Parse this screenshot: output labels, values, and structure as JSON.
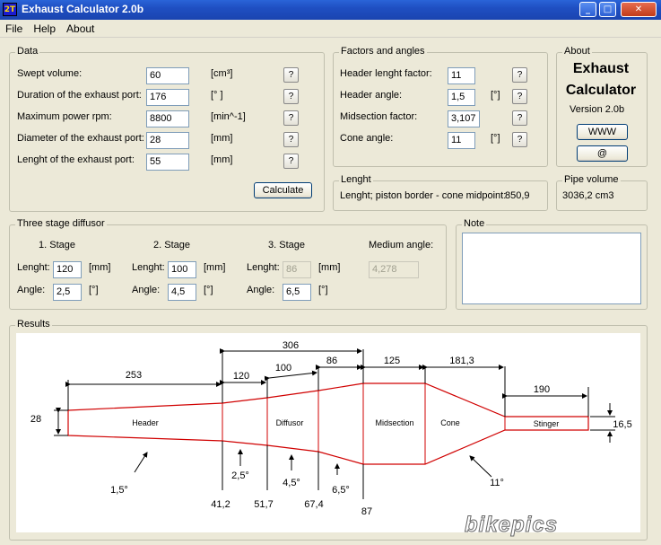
{
  "window": {
    "app_icon": "2T",
    "title": "Exhaust Calculator 2.0b",
    "min": "_",
    "max": "□",
    "close": "✕"
  },
  "menu": [
    "File",
    "Help",
    "About"
  ],
  "data_group": {
    "legend": "Data",
    "rows": [
      {
        "label": "Swept volume:",
        "value": "60",
        "unit": "[cm³]"
      },
      {
        "label": "Duration of the exhaust port:",
        "value": "176",
        "unit": "[° ]"
      },
      {
        "label": "Maximum power rpm:",
        "value": "8800",
        "unit": "[min^-1]"
      },
      {
        "label": "Diameter of the exhaust port:",
        "value": "28",
        "unit": "[mm]"
      },
      {
        "label": "Lenght of the exhaust port:",
        "value": "55",
        "unit": "[mm]"
      }
    ],
    "help": "?",
    "calculate": "Calculate"
  },
  "factors_group": {
    "legend": "Factors and angles",
    "rows": [
      {
        "label": "Header lenght factor:",
        "value": "11",
        "unit": ""
      },
      {
        "label": "Header angle:",
        "value": "1,5",
        "unit": "[°]"
      },
      {
        "label": "Midsection factor:",
        "value": "3,107",
        "unit": ""
      },
      {
        "label": "Cone angle:",
        "value": "11",
        "unit": "[°]"
      }
    ]
  },
  "about_group": {
    "legend": "About",
    "line1": "Exhaust",
    "line2": "Calculator",
    "version": "Version 2.0b",
    "www": "WWW",
    "mail": "@"
  },
  "lenght_group": {
    "legend": "Lenght",
    "text": "Lenght; piston border - cone midpoint:",
    "value": "850,9"
  },
  "pipe_group": {
    "legend": "Pipe volume",
    "value": "3036,2 cm3"
  },
  "diffusor_group": {
    "legend": "Three stage diffusor",
    "stages": [
      {
        "title": "1. Stage",
        "len_label": "Lenght:",
        "len": "120",
        "len_unit": "[mm]",
        "ang_label": "Angle:",
        "ang": "2,5",
        "ang_unit": "[°]"
      },
      {
        "title": "2. Stage",
        "len_label": "Lenght:",
        "len": "100",
        "len_unit": "[mm]",
        "ang_label": "Angle:",
        "ang": "4,5",
        "ang_unit": "[°]"
      },
      {
        "title": "3. Stage",
        "len_label": "Lenght:",
        "len": "86",
        "len_unit": "[mm]",
        "ang_label": "Angle:",
        "ang": "6,5",
        "ang_unit": "[°]"
      }
    ],
    "medium_label": "Medium angle:",
    "medium_value": "4,278"
  },
  "note_group": {
    "legend": "Note",
    "text": ""
  },
  "results_group": {
    "legend": "Results",
    "sections": [
      "Header",
      "Diffusor",
      "Midsection",
      "Cone",
      "Stinger"
    ],
    "dims_top": [
      "306",
      "253",
      "120",
      "100",
      "86",
      "125",
      "181,3",
      "190"
    ],
    "dia_in": "28",
    "dia_out": "16,5",
    "angles": [
      "1,5°",
      "2,5°",
      "4,5°",
      "6,5°",
      "11°"
    ],
    "diameters_bottom": [
      "41,2",
      "51,7",
      "67,4",
      "87"
    ],
    "colors": {
      "pipe": "#d00000",
      "dims": "#000000"
    }
  },
  "watermark": "bikepics"
}
